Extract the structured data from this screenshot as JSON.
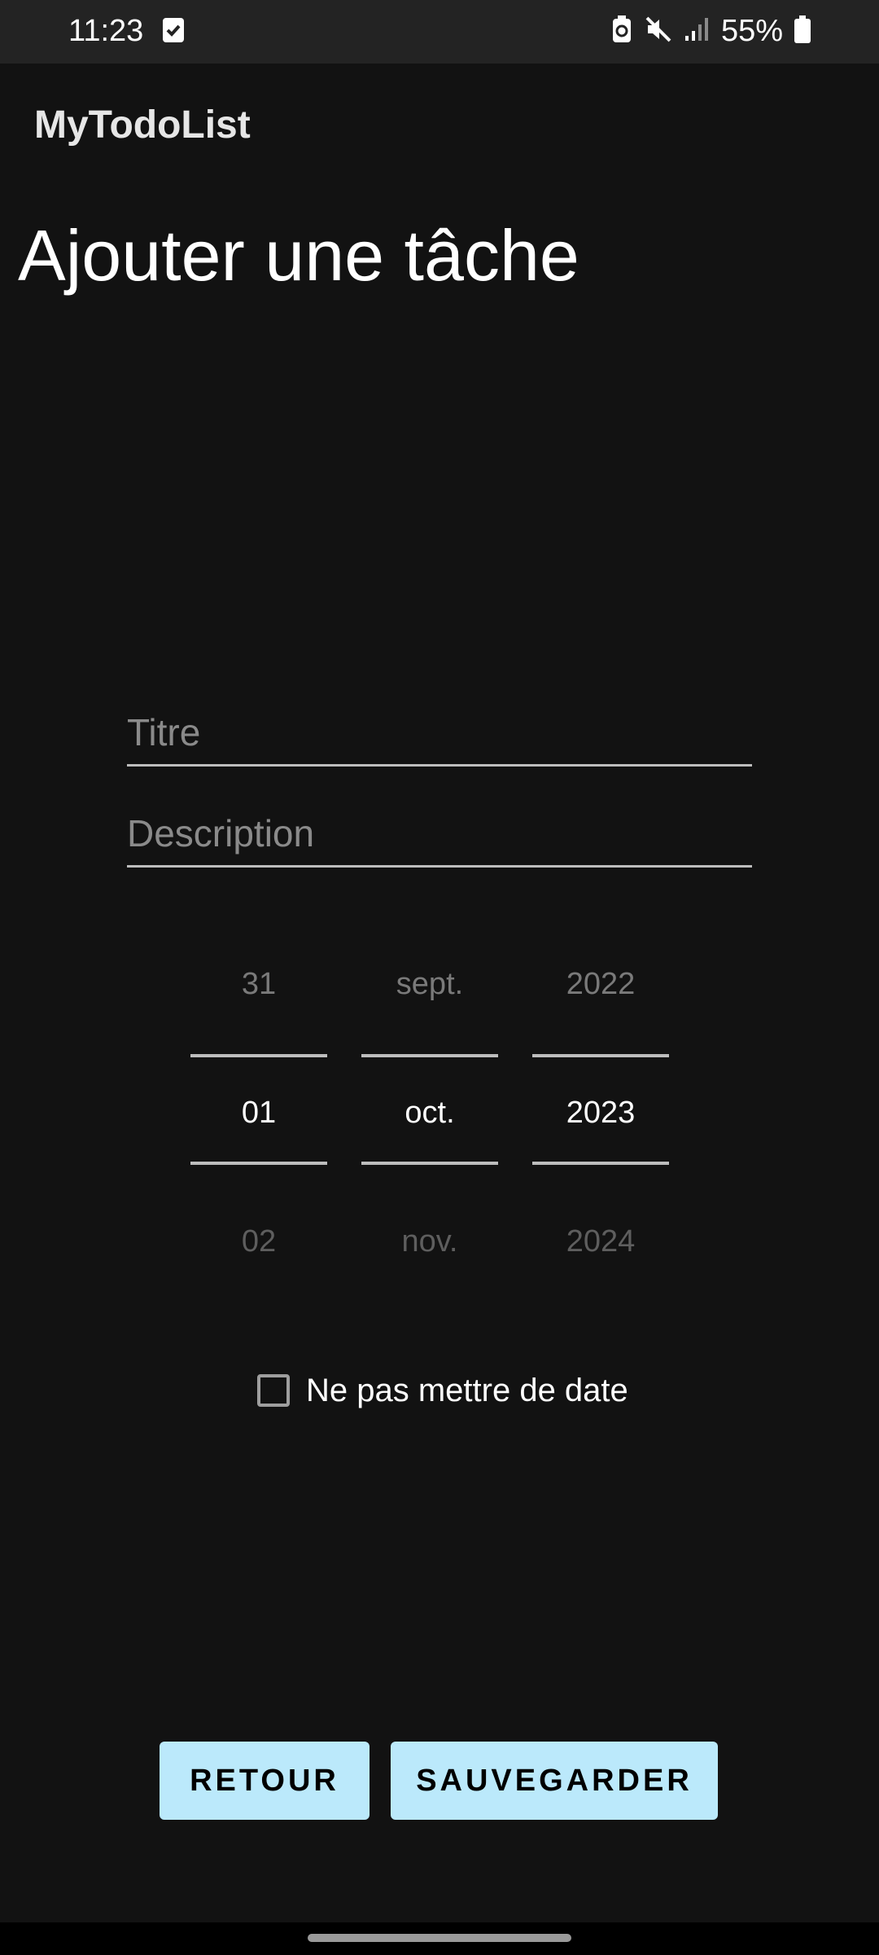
{
  "status_bar": {
    "time": "11:23",
    "battery_percent": "55%",
    "icons": [
      "checkbox-notification-icon",
      "battery-saver-icon",
      "mute-icon",
      "signal-icon",
      "battery-icon"
    ]
  },
  "app": {
    "title": "MyTodoList"
  },
  "page": {
    "heading": "Ajouter une tâche"
  },
  "form": {
    "title_placeholder": "Titre",
    "title_value": "",
    "description_placeholder": "Description",
    "description_value": ""
  },
  "date_picker": {
    "day": {
      "prev": "31",
      "selected": "01",
      "next": "02"
    },
    "month": {
      "prev": "sept.",
      "selected": "oct.",
      "next": "nov."
    },
    "year": {
      "prev": "2022",
      "selected": "2023",
      "next": "2024"
    }
  },
  "no_date_checkbox": {
    "label": "Ne pas mettre de date",
    "checked": false
  },
  "buttons": {
    "back_label": "RETOUR",
    "save_label": "SAUVEGARDER"
  },
  "colors": {
    "background": "#121212",
    "status_bar": "#232323",
    "button_bg": "#bbe9fb",
    "text_primary": "#ffffff",
    "text_hint": "#8a8a8a"
  }
}
